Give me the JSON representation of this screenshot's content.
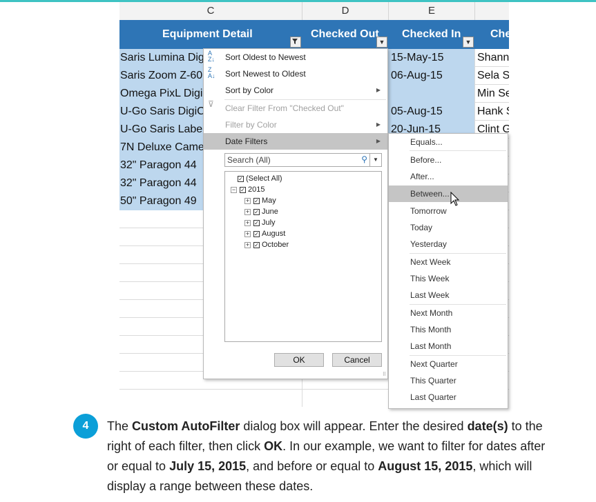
{
  "columns": [
    "C",
    "D",
    "E"
  ],
  "headers": {
    "c": "Equipment Detail",
    "d": "Checked Out",
    "e": "Checked In",
    "f": "Che"
  },
  "rows": [
    {
      "c": "Saris Lumina Dig",
      "e": "15-May-15",
      "f": "Shann"
    },
    {
      "c": "Saris Zoom Z-60",
      "e": "06-Aug-15",
      "f": "Sela Sl"
    },
    {
      "c": "Omega PixL Digi",
      "e": "",
      "f": "Min Se"
    },
    {
      "c": "U-Go Saris DigiC",
      "e": "05-Aug-15",
      "f": "Hank S"
    },
    {
      "c": "U-Go Saris Labe",
      "e": "20-Jun-15",
      "f": "Clint G"
    },
    {
      "c": "7N Deluxe Came",
      "e": "",
      "f": ""
    },
    {
      "c": "32\" Paragon 44",
      "e": "",
      "f": ""
    },
    {
      "c": "32\" Paragon 44",
      "e": "",
      "f": ""
    },
    {
      "c": "50\" Paragon 49",
      "e": "",
      "f": ""
    }
  ],
  "menu": {
    "sort_asc": "Sort Oldest to Newest",
    "sort_desc": "Sort Newest to Oldest",
    "sort_color": "Sort by Color",
    "clear_filter": "Clear Filter From \"Checked Out\"",
    "filter_color": "Filter by Color",
    "date_filters": "Date Filters",
    "search_placeholder": "Search (All)",
    "tree": {
      "select_all": "(Select All)",
      "year": "2015",
      "months": [
        "May",
        "June",
        "July",
        "August",
        "October"
      ]
    },
    "ok": "OK",
    "cancel": "Cancel"
  },
  "submenu": {
    "items": [
      "Equals...",
      "Before...",
      "After...",
      "Between...",
      "Tomorrow",
      "Today",
      "Yesterday",
      "Next Week",
      "This Week",
      "Last Week",
      "Next Month",
      "This Month",
      "Last Month",
      "Next Quarter",
      "This Quarter",
      "Last Quarter"
    ],
    "highlighted": "Between..."
  },
  "step": {
    "number": "4",
    "t1": "The ",
    "b1": "Custom AutoFilter",
    "t2": " dialog box will appear. Enter the desired ",
    "b2": "date(s)",
    "t3": " to the right of each filter, then click ",
    "b3": "OK",
    "t4": ". In our example, we want to filter for dates after or equal to ",
    "b4": "July 15, 2015",
    "t5": ", and before or equal to ",
    "b5": "August 15, 2015",
    "t6": ", which will display a range between these dates."
  }
}
